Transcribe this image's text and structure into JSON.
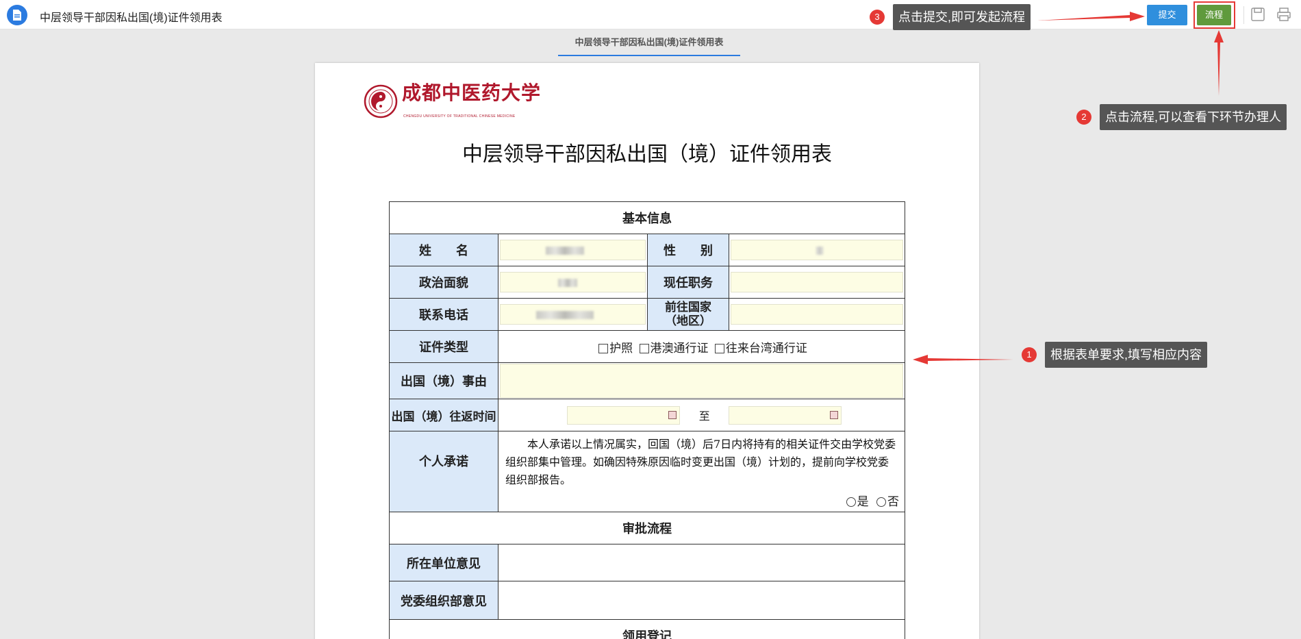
{
  "app": {
    "title": "中层领导干部因私出国(境)证件领用表",
    "icon": "document-icon"
  },
  "toolbar": {
    "submit_label": "提交",
    "flow_label": "流程",
    "save_icon": "save-icon",
    "print_icon": "print-icon"
  },
  "tab": {
    "label": "中层领导干部因私出国(境)证件领用表"
  },
  "logo": {
    "text": "成都中医药大学",
    "subtext": "CHENGDU UNIVERSITY OF TRADITIONAL CHINESE MEDICINE"
  },
  "doc_title": "中层领导干部因私出国（境）证件领用表",
  "form": {
    "section_basic": "基本信息",
    "name_label": "姓　　名",
    "gender_label": "性　　别",
    "politics_label": "政治面貌",
    "position_label": "现任职务",
    "phone_label": "联系电话",
    "country_label_1": "前往国家",
    "country_label_2": "（地区）",
    "cert_label": "证件类型",
    "cert_options": [
      "护照",
      "港澳通行证",
      "往来台湾通行证"
    ],
    "reason_label": "出国（境）事由",
    "time_label": "出国（境）往返时间",
    "time_to": "至",
    "promise_label": "个人承诺",
    "promise_text": "本人承诺以上情况属实，回国（境）后7日内将持有的相关证件交由学校党委组织部集中管理。如确因特殊原因临时变更出国（境）计划的，提前向学校党委组织部报告。",
    "promise_yes": "是",
    "promise_no": "否",
    "section_approval": "审批流程",
    "unit_opinion_label": "所在单位意见",
    "party_opinion_label": "党委组织部意见",
    "section_register": "领用登记"
  },
  "annotations": {
    "tip1": {
      "num": "1",
      "text": "根据表单要求,填写相应内容"
    },
    "tip2": {
      "num": "2",
      "text": "点击流程,可以查看下环节办理人"
    },
    "tip3": {
      "num": "3",
      "text": "点击提交,即可发起流程"
    }
  },
  "colors": {
    "accent": "#2b7be0",
    "submit": "#2f8fdd",
    "flow": "#5f9a3c",
    "annotation": "#e53935",
    "label_bg": "#dbe9f9",
    "field_bg": "#fdfde4"
  }
}
